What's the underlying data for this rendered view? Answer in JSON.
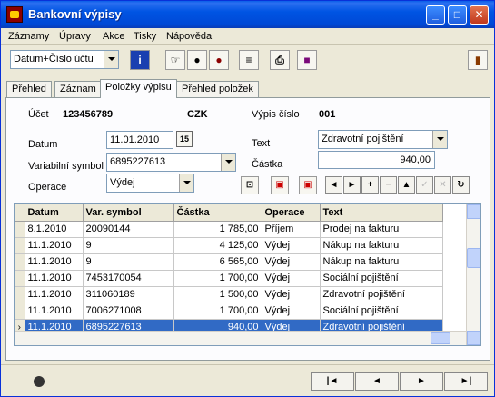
{
  "window": {
    "title": "Bankovní výpisy"
  },
  "menu": [
    "Záznamy",
    "Úpravy",
    "Akce",
    "Tisky",
    "Nápověda"
  ],
  "toolbar": {
    "sort_combo": "Datum+Číslo účtu"
  },
  "tabs": [
    "Přehled",
    "Záznam",
    "Položky výpisu",
    "Přehled položek"
  ],
  "header": {
    "account_label": "Účet",
    "account_value": "123456789",
    "currency": "CZK",
    "statement_label": "Výpis číslo",
    "statement_value": "001"
  },
  "form": {
    "date_label": "Datum",
    "date_value": "11.01.2010",
    "date_button": "15",
    "var_symbol_label": "Variabilní symbol",
    "var_symbol_value": "6895227613",
    "operation_label": "Operace",
    "operation_value": "Výdej",
    "text_label": "Text",
    "text_value": "Zdravotní pojištění",
    "amount_label": "Částka",
    "amount_value": "940,00"
  },
  "grid": {
    "columns": [
      "Datum",
      "Var. symbol",
      "Částka",
      "Operace",
      "Text"
    ],
    "rows": [
      [
        "8.1.2010",
        "20090144",
        "1 785,00",
        "Příjem",
        "Prodej na fakturu"
      ],
      [
        "11.1.2010",
        "9",
        "4 125,00",
        "Výdej",
        "Nákup na fakturu"
      ],
      [
        "11.1.2010",
        "9",
        "6 565,00",
        "Výdej",
        "Nákup na fakturu"
      ],
      [
        "11.1.2010",
        "7453170054",
        "1 700,00",
        "Výdej",
        "Sociální pojištění"
      ],
      [
        "11.1.2010",
        "311060189",
        "1 500,00",
        "Výdej",
        "Zdravotní pojištění"
      ],
      [
        "11.1.2010",
        "7006271008",
        "1 700,00",
        "Výdej",
        "Sociální pojištění"
      ],
      [
        "11.1.2010",
        "6895227613",
        "940,00",
        "Výdej",
        "Zdravotní pojištění"
      ]
    ],
    "selected_row": 6
  },
  "icons": {
    "title": "app-icon",
    "navigator": [
      "first-icon",
      "previous-icon",
      "next-icon",
      "last-icon"
    ],
    "record_nav": [
      "prev-record-icon",
      "next-record-icon",
      "add-icon",
      "delete-icon",
      "edit-icon",
      "post-icon",
      "cancel-icon",
      "refresh-icon"
    ]
  },
  "colors": {
    "selection": "#316ac5",
    "titlebar": "#0054e3"
  }
}
